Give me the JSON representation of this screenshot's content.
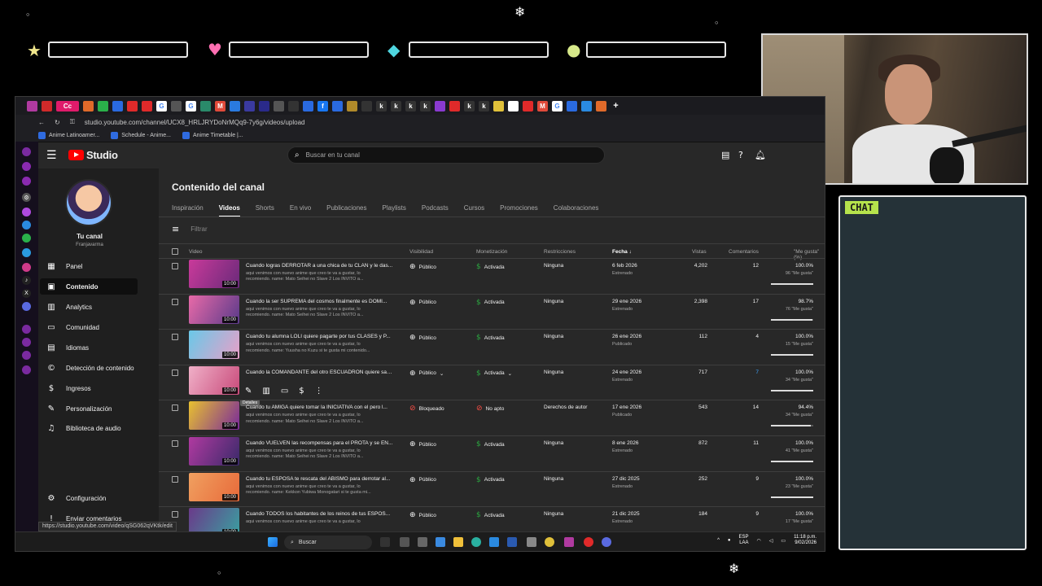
{
  "overlay": {
    "hp_icons": [
      "star-icon",
      "heart-icon",
      "diamond-icon",
      "coin-icon"
    ],
    "chat_label": "CHAT"
  },
  "browser": {
    "active_tab": "Cc",
    "url": "studio.youtube.com/channel/UCX8_HRLJRYDoNrMQq9-7y6g/videos/upload",
    "bookmarks": [
      "Anime Latinoamer...",
      "Schedule - Anime...",
      "Anime Timetable |..."
    ],
    "status_url": "https://studio.youtube.com/video/qSG062qVKtk/edit"
  },
  "studio": {
    "logo_text": "Studio",
    "search_placeholder": "Buscar en tu canal",
    "channel_name": "Tu canal",
    "channel_handle": "Franjavarma",
    "nav": [
      {
        "label": "Panel",
        "icon": "dashboard-icon"
      },
      {
        "label": "Contenido",
        "icon": "content-icon"
      },
      {
        "label": "Analytics",
        "icon": "analytics-icon"
      },
      {
        "label": "Comunidad",
        "icon": "community-icon"
      },
      {
        "label": "Idiomas",
        "icon": "subtitles-icon"
      },
      {
        "label": "Detección de contenido",
        "icon": "copyright-icon"
      },
      {
        "label": "Ingresos",
        "icon": "earn-icon"
      },
      {
        "label": "Personalización",
        "icon": "customization-icon"
      },
      {
        "label": "Biblioteca de audio",
        "icon": "audio-library-icon"
      }
    ],
    "nav_bottom": [
      "Configuración",
      "Enviar comentarios"
    ],
    "page_title": "Contenido del canal",
    "tabs": [
      "Inspiración",
      "Videos",
      "Shorts",
      "En vivo",
      "Publicaciones",
      "Playlists",
      "Podcasts",
      "Cursos",
      "Promociones",
      "Colaboraciones"
    ],
    "active_tab": "Videos",
    "filter_placeholder": "Filtrar",
    "columns": {
      "video": "Video",
      "visibility": "Visibilidad",
      "monetization": "Monetización",
      "restrictions": "Restricciones",
      "date": "Fecha",
      "views": "Vistas",
      "comments": "Comentarios",
      "likes": "\"Me gusta\" (%)"
    },
    "tooltip": "Detalles",
    "rows": [
      {
        "title": "Cuando logras DERROTAR a una chica de tu CLAN y le das...",
        "desc1": "aqui venimos con nuevo anime que creo te va a gustar, lo",
        "desc2": "recomiendo. name: Mato Seihei no Slave 2 Los INVITO a...",
        "duration": "10:00",
        "visibility": "Público",
        "monetization": "Activada",
        "restrictions": "Ninguna",
        "date": "6 feb 2026",
        "date_sub": "Estrenado",
        "views": "4,202",
        "comments": "12",
        "likes": "100.0%",
        "likes_sub": "96 \"Me gusta\"",
        "like_ratio": 1.0,
        "thumb": [
          "#c93a9a",
          "#6a2a7a"
        ]
      },
      {
        "title": "Cuando la ser SUPREMA del cosmos finalmente es DOMI...",
        "desc1": "aqui venimos con nuevo anime que creo te va a gustar, lo",
        "desc2": "recomiendo. name: Mato Seihei no Slave 2 Los INVITO a...",
        "duration": "10:00",
        "visibility": "Público",
        "monetization": "Activada",
        "restrictions": "Ninguna",
        "date": "29 ene 2026",
        "date_sub": "Estrenado",
        "views": "2,398",
        "comments": "17",
        "likes": "98.7%",
        "likes_sub": "76 \"Me gusta\"",
        "like_ratio": 0.987,
        "thumb": [
          "#e86aa8",
          "#5a3a8a"
        ]
      },
      {
        "title": "Cuando tu alumna LOLI quiere pagarte por tus CLASES y P...",
        "desc1": "aqui venimos con nuevo anime que creo te va a gustar, lo",
        "desc2": "recomiendo. name: Yuusha no Kuzu si te gusta mi contenido...",
        "duration": "10:00",
        "visibility": "Público",
        "monetization": "Activada",
        "restrictions": "Ninguna",
        "date": "26 ene 2026",
        "date_sub": "Publicado",
        "views": "112",
        "comments": "4",
        "likes": "100.0%",
        "likes_sub": "15 \"Me gusta\"",
        "like_ratio": 1.0,
        "thumb": [
          "#6ac8e8",
          "#e8a0c8"
        ]
      },
      {
        "title": "Cuando la COMANDANTE del otro ESCUADRON quiere sab...",
        "desc1": "",
        "desc2": "",
        "duration": "10:00",
        "visibility": "Público",
        "monetization": "Activada",
        "restrictions": "Ninguna",
        "date": "24 ene 2026",
        "date_sub": "Estrenado",
        "views": "717",
        "comments": "7",
        "likes": "100.0%",
        "likes_sub": "34 \"Me gusta\"",
        "like_ratio": 1.0,
        "thumb": [
          "#f0b0c8",
          "#c84a7a"
        ]
      },
      {
        "title": "Cuando tu AMIGA quiere tomar la INICIATIVA con el pero l...",
        "desc1": "aqui venimos con nuevo anime que creo te va a gustar, lo",
        "desc2": "recomiendo. name: Mato Seihei no Slave 2 Los INVITO a...",
        "duration": "10:00",
        "visibility": "Bloqueado",
        "monetization": "No apto",
        "restrictions": "Derechos de autor",
        "date": "17 ene 2026",
        "date_sub": "Publicado",
        "views": "543",
        "comments": "14",
        "likes": "94.4%",
        "likes_sub": "34 \"Me gusta\"",
        "like_ratio": 0.944,
        "thumb": [
          "#e8c030",
          "#7a2a9a"
        ]
      },
      {
        "title": "Cuando VUELVEN las recompensas para el PROTA y se EN...",
        "desc1": "aqui venimos con nuevo anime que creo te va a gustar, lo",
        "desc2": "recomiendo. name: Mato Seihei no Slave 2 Los INVITO a...",
        "duration": "10:00",
        "visibility": "Público",
        "monetization": "Activada",
        "restrictions": "Ninguna",
        "date": "8 ene 2026",
        "date_sub": "Estrenado",
        "views": "872",
        "comments": "11",
        "likes": "100.0%",
        "likes_sub": "41 \"Me gusta\"",
        "like_ratio": 1.0,
        "thumb": [
          "#b03aa0",
          "#3a2a6a"
        ]
      },
      {
        "title": "Cuando tu ESPOSA te rescata del ABISMO para derrotar al...",
        "desc1": "aqui venimos con nuevo anime que creo te va a gustar, lo",
        "desc2": "recomiendo. name: Kekkon Yubiwa Monogatari si te gusta mi...",
        "duration": "10:00",
        "visibility": "Público",
        "monetization": "Activada",
        "restrictions": "Ninguna",
        "date": "27 dic 2025",
        "date_sub": "Estrenado",
        "views": "252",
        "comments": "9",
        "likes": "100.0%",
        "likes_sub": "23 \"Me gusta\"",
        "like_ratio": 1.0,
        "thumb": [
          "#f0a060",
          "#e86a3a"
        ]
      },
      {
        "title": "Cuando TODOS los habitantes de los reinos de tus ESPOS...",
        "desc1": "aqui venimos con nuevo anime que creo te va a gustar, lo",
        "desc2": "",
        "duration": "10:00",
        "visibility": "Público",
        "monetization": "Activada",
        "restrictions": "Ninguna",
        "date": "21 dic 2025",
        "date_sub": "Estrenado",
        "views": "184",
        "comments": "9",
        "likes": "100.0%",
        "likes_sub": "17 \"Me gusta\"",
        "like_ratio": 1.0,
        "thumb": [
          "#6a3a8a",
          "#3aa0a0"
        ]
      }
    ]
  },
  "taskbar": {
    "search_label": "Buscar",
    "lang1": "ESP",
    "lang2": "LAA",
    "time": "11:18 p.m.",
    "date": "9/02/2026"
  }
}
